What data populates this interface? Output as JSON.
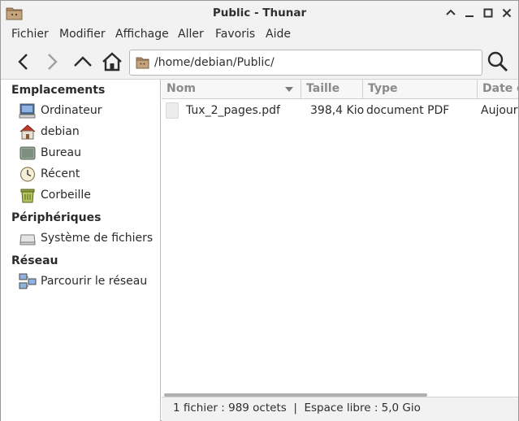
{
  "window": {
    "title": "Public - Thunar"
  },
  "titlebar": {
    "app_icon": "folder-icon",
    "buttons": [
      "maximize-icon",
      "minimize-icon",
      "restore-icon",
      "close-icon"
    ]
  },
  "menubar": {
    "items": [
      "Fichier",
      "Modifier",
      "Affichage",
      "Aller",
      "Favoris",
      "Aide"
    ]
  },
  "toolbar": {
    "back_icon": "chevron-left-icon",
    "forward_icon": "chevron-right-icon",
    "up_icon": "chevron-up-icon",
    "home_icon": "home-icon",
    "location": "/home/debian/Public/",
    "search_icon": "search-icon"
  },
  "sidebar": {
    "sections": [
      {
        "title": "Emplacements",
        "items": [
          {
            "label": "Ordinateur",
            "icon": "computer-icon"
          },
          {
            "label": "debian",
            "icon": "home-folder-icon"
          },
          {
            "label": "Bureau",
            "icon": "desktop-icon"
          },
          {
            "label": "Récent",
            "icon": "clock-icon"
          },
          {
            "label": "Corbeille",
            "icon": "trash-icon"
          }
        ]
      },
      {
        "title": "Périphériques",
        "items": [
          {
            "label": "Système de fichiers",
            "icon": "drive-icon"
          }
        ]
      },
      {
        "title": "Réseau",
        "items": [
          {
            "label": "Parcourir le réseau",
            "icon": "network-icon"
          }
        ]
      }
    ]
  },
  "file_list": {
    "columns": [
      "Nom",
      "Taille",
      "Type",
      "Date de modification"
    ],
    "rows": [
      {
        "name": "Tux_2_pages.pdf",
        "size": "398,4 Kio",
        "type": "document PDF",
        "date": "Aujourd'hui"
      }
    ]
  },
  "statusbar": {
    "text": "1 fichier : 989 octets  |  Espace libre : 5,0 Gio"
  }
}
